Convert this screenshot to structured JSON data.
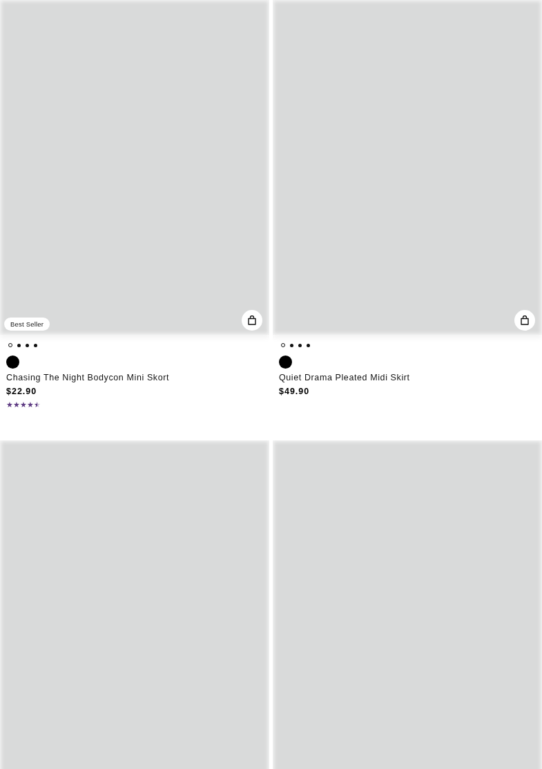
{
  "products": [
    {
      "image_loaded": false,
      "badge": "Best Seller",
      "image_dots": [
        {
          "selected": true
        },
        {
          "selected": false
        },
        {
          "selected": false
        },
        {
          "selected": false
        }
      ],
      "swatches": [
        {
          "color": "#000000"
        }
      ],
      "name": "Chasing The Night Bodycon Mini Skort",
      "price": "$22.90",
      "stars": 4.5
    },
    {
      "image_loaded": false,
      "image_dots": [
        {
          "selected": true
        },
        {
          "selected": false
        },
        {
          "selected": false
        },
        {
          "selected": false
        }
      ],
      "swatches": [
        {
          "color": "#000000"
        }
      ],
      "name": "Quiet Drama Pleated Midi Skirt",
      "price": "$49.90"
    },
    {
      "image_loaded": false
    },
    {
      "image_loaded": false
    }
  ]
}
